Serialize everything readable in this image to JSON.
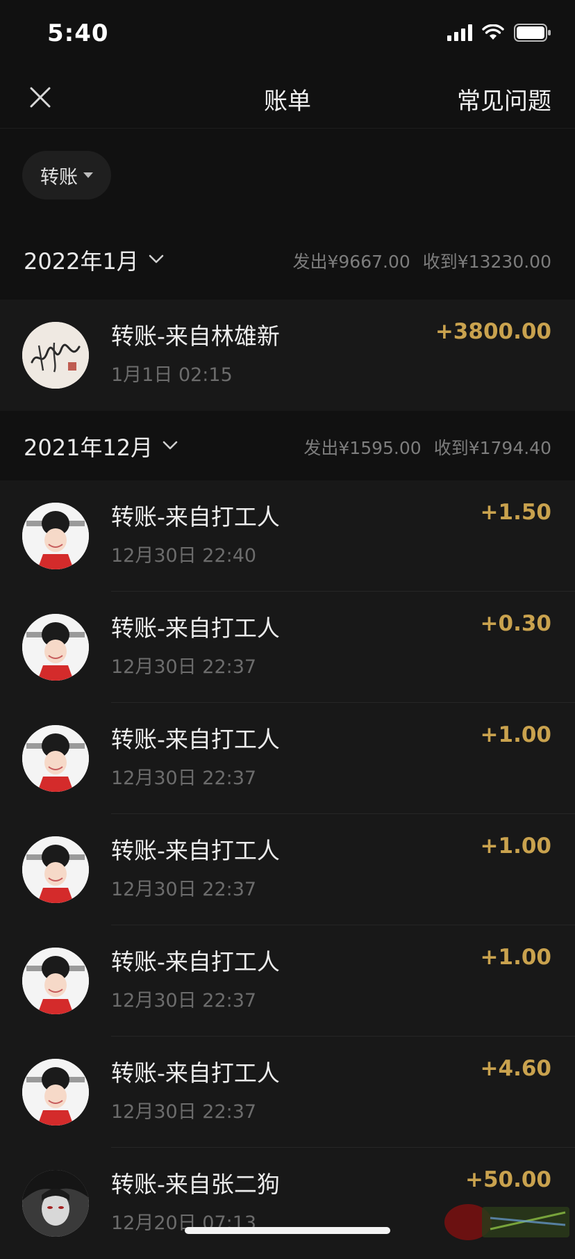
{
  "status_bar": {
    "time": "5:40"
  },
  "nav": {
    "title": "账单",
    "faq": "常见问题"
  },
  "filter": {
    "label": "转账"
  },
  "months": [
    {
      "label": "2022年1月",
      "sent": "发出¥9667.00",
      "received": "收到¥13230.00",
      "transactions": [
        {
          "title": "转账-来自林雄新",
          "time": "1月1日 02:15",
          "amount": "+3800.00",
          "avatar": "signature-avatar"
        }
      ]
    },
    {
      "label": "2021年12月",
      "sent": "发出¥1595.00",
      "received": "收到¥1794.40",
      "transactions": [
        {
          "title": "转账-来自打工人",
          "time": "12月30日 22:40",
          "amount": "+1.50",
          "avatar": "cartoon-official-avatar"
        },
        {
          "title": "转账-来自打工人",
          "time": "12月30日 22:37",
          "amount": "+0.30",
          "avatar": "cartoon-official-avatar"
        },
        {
          "title": "转账-来自打工人",
          "time": "12月30日 22:37",
          "amount": "+1.00",
          "avatar": "cartoon-official-avatar"
        },
        {
          "title": "转账-来自打工人",
          "time": "12月30日 22:37",
          "amount": "+1.00",
          "avatar": "cartoon-official-avatar"
        },
        {
          "title": "转账-来自打工人",
          "time": "12月30日 22:37",
          "amount": "+1.00",
          "avatar": "cartoon-official-avatar"
        },
        {
          "title": "转账-来自打工人",
          "time": "12月30日 22:37",
          "amount": "+4.60",
          "avatar": "cartoon-official-avatar"
        },
        {
          "title": "转账-来自张二狗",
          "time": "12月20日 07:13",
          "amount": "+50.00",
          "avatar": "anime-character-avatar"
        }
      ]
    }
  ],
  "colors": {
    "background": "#111111",
    "row_background": "#181818",
    "amount": "#c9a24e",
    "secondary_text": "#6c6c6c"
  }
}
